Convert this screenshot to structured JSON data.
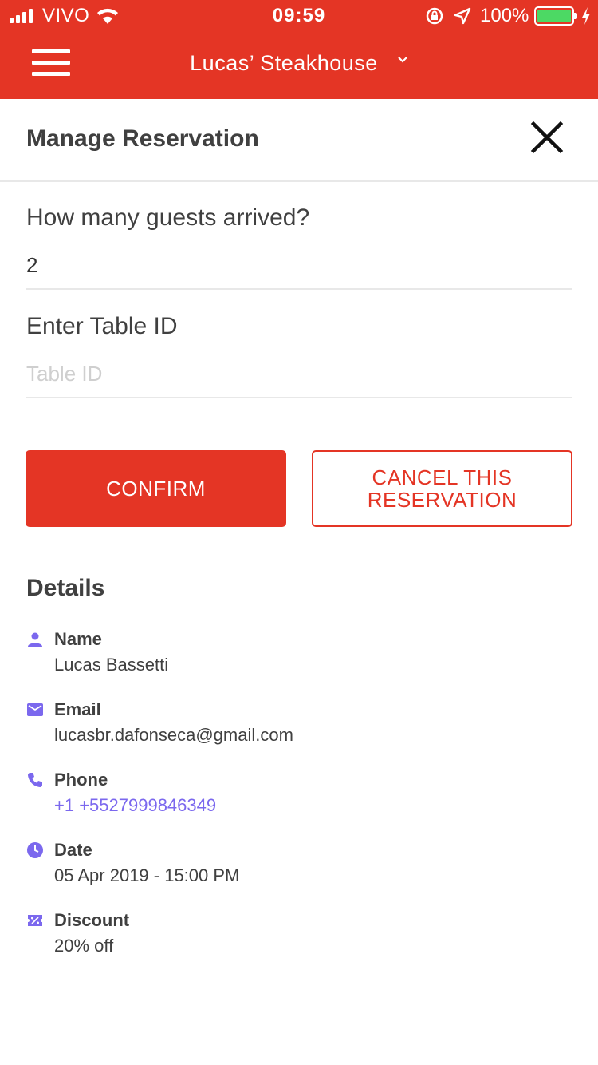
{
  "status_bar": {
    "carrier": "VIVO",
    "time": "09:59",
    "battery": "100%"
  },
  "app_bar": {
    "venue_name": "Lucas’ Steakhouse"
  },
  "header": {
    "title": "Manage Reservation"
  },
  "form": {
    "guests_label": "How many guests arrived?",
    "guests_value": "2",
    "table_label": "Enter Table ID",
    "table_placeholder": "Table ID",
    "table_value": ""
  },
  "actions": {
    "confirm_label": "CONFIRM",
    "cancel_label": "CANCEL THIS RESERVATION"
  },
  "details": {
    "title": "Details",
    "items": [
      {
        "icon": "person-icon",
        "label": "Name",
        "value": "Lucas Bassetti"
      },
      {
        "icon": "email-icon",
        "label": "Email",
        "value": "lucasbr.dafonseca@gmail.com"
      },
      {
        "icon": "phone-icon",
        "label": "Phone",
        "value": "+1 +5527999846349"
      },
      {
        "icon": "clock-icon",
        "label": "Date",
        "value": "05 Apr 2019 - 15:00 PM"
      },
      {
        "icon": "discount-icon",
        "label": "Discount",
        "value": "20% off"
      }
    ]
  },
  "colors": {
    "brand": "#e43525",
    "icon_accent": "#7b68ee",
    "link": "#7b68ee"
  }
}
